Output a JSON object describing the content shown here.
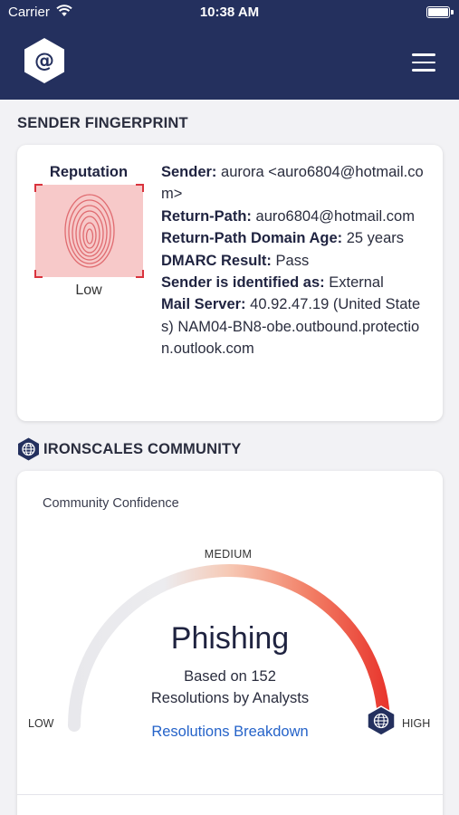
{
  "status_bar": {
    "carrier": "Carrier",
    "time": "10:38 AM"
  },
  "nav": {
    "logo_icon": "at-sign-hexagon-logo",
    "menu_icon": "hamburger-menu-icon"
  },
  "sender_section": {
    "title": "SENDER FINGERPRINT",
    "reputation_label": "Reputation",
    "reputation_value": "Low",
    "fingerprint_icon": "fingerprint-icon",
    "fields": [
      {
        "label": "Sender:",
        "value": "aurora <auro6804@hotmail.com>"
      },
      {
        "label": "Return-Path:",
        "value": "auro6804@hotmail.com"
      },
      {
        "label": "Return-Path Domain Age:",
        "value": "25 years"
      },
      {
        "label": "DMARC Result:",
        "value": "Pass"
      },
      {
        "label": "Sender is identified as:",
        "value": "External"
      },
      {
        "label": "Mail Server:",
        "value": "40.92.47.19 (United States) NAM04-BN8-obe.outbound.protection.outlook.com"
      }
    ]
  },
  "community_section": {
    "title": "IRONSCALES COMMUNITY",
    "confidence_label": "Community Confidence",
    "gauge": {
      "low": "LOW",
      "medium": "MEDIUM",
      "high": "HIGH",
      "level": 1.0
    },
    "verdict": "Phishing",
    "based_on_line1": "Based on 152",
    "based_on_line2": "Resolutions by Analysts",
    "breakdown_link": "Resolutions Breakdown"
  },
  "colors": {
    "nav_bg": "#24305e",
    "low_red": "#d9333d",
    "link_blue": "#2563c9",
    "gauge_red": "#e8332b"
  }
}
